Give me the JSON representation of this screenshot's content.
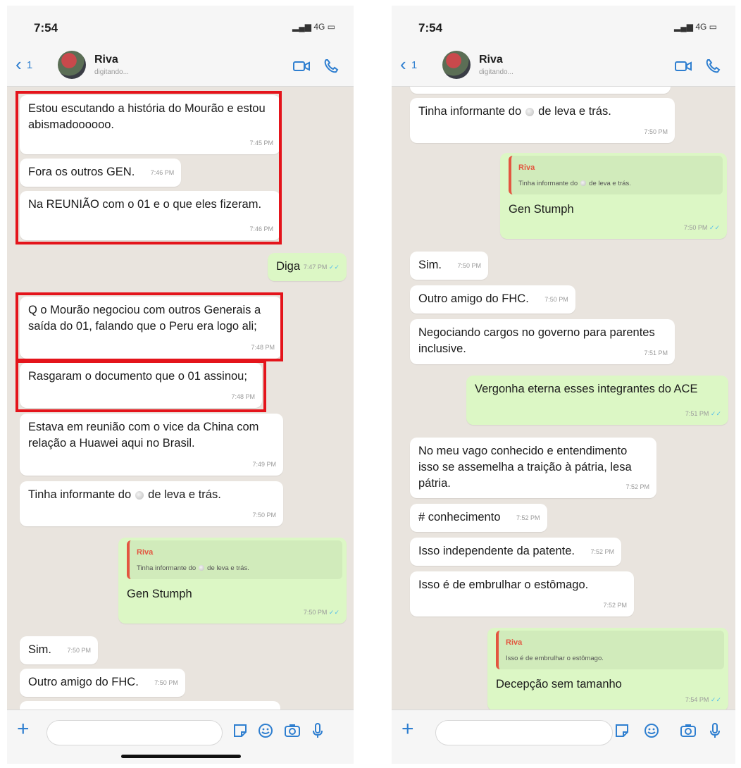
{
  "left": {
    "status": {
      "time": "7:54",
      "network": "4G"
    },
    "header": {
      "back_count": "1",
      "name": "Riva",
      "status": "digitando..."
    },
    "messages": [
      {
        "text": "Estou escutando a história  do Mourão e estou abismadoooooo.",
        "time": "7:45 PM"
      },
      {
        "text": "Fora os outros GEN.",
        "time": "7:46 PM"
      },
      {
        "text": "Na REUNIÃO com o 01 e o que eles fizeram.",
        "time": "7:46 PM"
      },
      {
        "text": "Diga",
        "time": "7:47 PM"
      },
      {
        "text": "Q o Mourão negociou com outros Generais a saída do 01, falando que o Peru era logo ali;",
        "time": "7:48 PM"
      },
      {
        "text": "Rasgaram o documento que o 01 assinou;",
        "time": "7:48 PM"
      },
      {
        "text": "Estava em reunião com o vice da China com relação a Huawei aqui no Brasil.",
        "time": "7:49 PM"
      },
      {
        "text_a": "Tinha informante do",
        "text_b": "de leva e trás.",
        "time": "7:50 PM"
      },
      {
        "quote_name": "Riva",
        "quote_a": "Tinha informante do",
        "quote_b": "de leva e trás.",
        "text": "Gen Stumph",
        "time": "7:50 PM"
      },
      {
        "text": "Sim.",
        "time": "7:50 PM"
      },
      {
        "text": "Outro amigo do FHC.",
        "time": "7:50 PM"
      }
    ]
  },
  "right": {
    "status": {
      "time": "7:54",
      "network": "4G"
    },
    "header": {
      "back_count": "1",
      "name": "Riva",
      "status": "digitando..."
    },
    "messages": [
      {
        "text_a": "Tinha informante do",
        "text_b": "de leva e trás.",
        "time": "7:50 PM"
      },
      {
        "quote_name": "Riva",
        "quote_a": "Tinha informante do",
        "quote_b": "de leva e trás.",
        "text": "Gen Stumph",
        "time": "7:50 PM"
      },
      {
        "text": "Sim.",
        "time": "7:50 PM"
      },
      {
        "text": "Outro amigo do FHC.",
        "time": "7:50 PM"
      },
      {
        "text": "Negociando cargos no governo para parentes inclusive.",
        "time": "7:51 PM"
      },
      {
        "text": "Vergonha eterna esses integrantes do ACE",
        "time": "7:51 PM"
      },
      {
        "text": "No meu vago conhecido e entendimento isso se assemelha a traição à pátria, lesa pátria.",
        "time": "7:52 PM"
      },
      {
        "text": "# conhecimento",
        "time": "7:52 PM"
      },
      {
        "text": "Isso independente da patente.",
        "time": "7:52 PM"
      },
      {
        "text": "Isso é de embrulhar o estômago.",
        "time": "7:52 PM"
      },
      {
        "quote_name": "Riva",
        "quote_text": "Isso é de embrulhar o estômago.",
        "text": "Decepção sem tamanho",
        "time": "7:54 PM"
      }
    ]
  },
  "colors": {
    "accent": "#2f7fd0",
    "incoming": "#ffffff",
    "outgoing": "#dcf7c5",
    "highlight": "#e4141b",
    "quote_author": "#e35640"
  },
  "icons": [
    "back-chevron-icon",
    "video-call-icon",
    "phone-call-icon",
    "plus-icon",
    "sticker-icon",
    "emoji-icon",
    "camera-icon",
    "mic-icon",
    "double-check-icon"
  ]
}
